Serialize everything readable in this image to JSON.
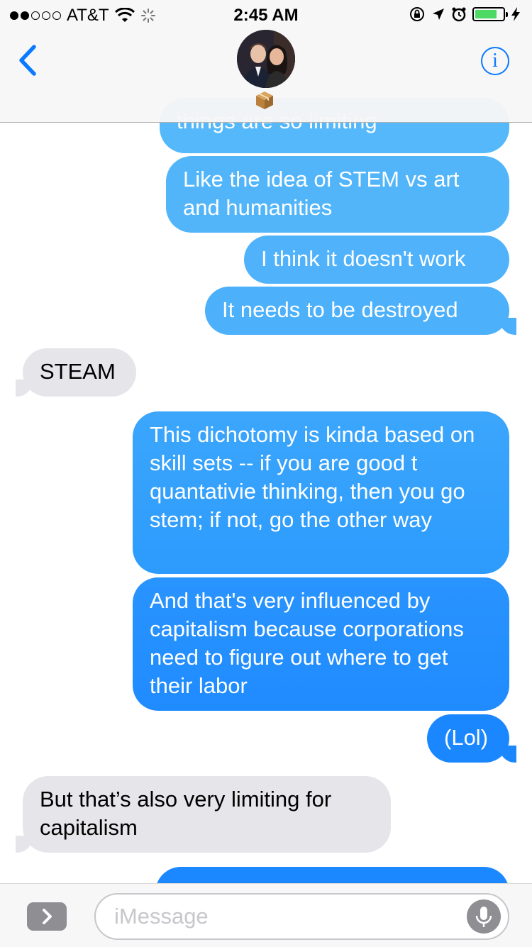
{
  "status_bar": {
    "carrier": "AT&T",
    "time": "2:45 AM",
    "signal_bars_filled": 2,
    "battery_level": 0.72
  },
  "header": {
    "back_icon": "chevron-left-icon",
    "info_label": "i",
    "sticker": "package-emoji"
  },
  "messages": [
    {
      "direction": "outgoing",
      "text": "things are so limiting"
    },
    {
      "direction": "outgoing",
      "text": "Like the idea of STEM vs art and humanities"
    },
    {
      "direction": "outgoing",
      "text": "I think it doesn't work"
    },
    {
      "direction": "outgoing",
      "text": "It needs to be destroyed"
    },
    {
      "direction": "incoming",
      "text": "STEAM"
    },
    {
      "direction": "outgoing",
      "text": "This dichotomy is kinda based on skill sets -- if you are good t quantativie thinking, then you go stem; if not, go the other way"
    },
    {
      "direction": "outgoing",
      "text": "And that's very influenced by capitalism because corporations need to figure out where to get their labor"
    },
    {
      "direction": "outgoing",
      "text": "(Lol)"
    },
    {
      "direction": "incoming",
      "text": "But that’s also very limiting for capitalism"
    },
    {
      "direction": "outgoing",
      "text": ""
    }
  ],
  "input_bar": {
    "placeholder": "iMessage"
  },
  "colors": {
    "ios_blue": "#0a7aff",
    "bubble_out_top": "#53b4fa",
    "bubble_out_bottom": "#1e8bff",
    "bubble_in": "#e5e5ea"
  }
}
